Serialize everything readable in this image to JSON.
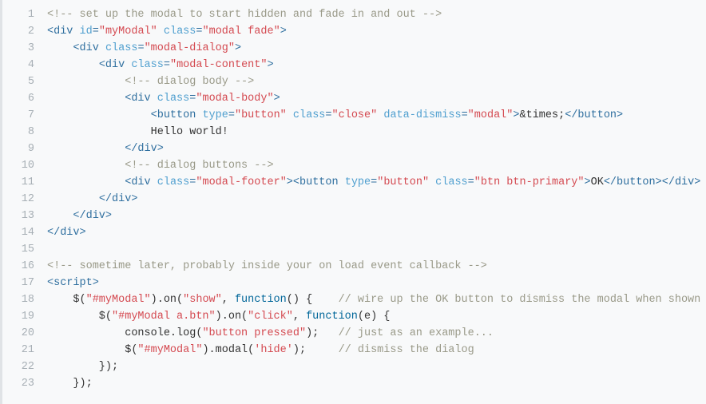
{
  "lines": [
    {
      "n": 1,
      "segs": [
        {
          "cls": "c",
          "t": "<!-- set up the modal to start hidden and fade in and out -->"
        }
      ]
    },
    {
      "n": 2,
      "segs": [
        {
          "cls": "p",
          "t": "<"
        },
        {
          "cls": "t",
          "t": "div"
        },
        {
          "cls": "x",
          "t": " "
        },
        {
          "cls": "a",
          "t": "id"
        },
        {
          "cls": "p",
          "t": "="
        },
        {
          "cls": "v",
          "t": "\"myModal\""
        },
        {
          "cls": "x",
          "t": " "
        },
        {
          "cls": "a",
          "t": "class"
        },
        {
          "cls": "p",
          "t": "="
        },
        {
          "cls": "v",
          "t": "\"modal fade\""
        },
        {
          "cls": "p",
          "t": ">"
        }
      ]
    },
    {
      "n": 3,
      "segs": [
        {
          "cls": "x",
          "t": "    "
        },
        {
          "cls": "p",
          "t": "<"
        },
        {
          "cls": "t",
          "t": "div"
        },
        {
          "cls": "x",
          "t": " "
        },
        {
          "cls": "a",
          "t": "class"
        },
        {
          "cls": "p",
          "t": "="
        },
        {
          "cls": "v",
          "t": "\"modal-dialog\""
        },
        {
          "cls": "p",
          "t": ">"
        }
      ]
    },
    {
      "n": 4,
      "segs": [
        {
          "cls": "x",
          "t": "        "
        },
        {
          "cls": "p",
          "t": "<"
        },
        {
          "cls": "t",
          "t": "div"
        },
        {
          "cls": "x",
          "t": " "
        },
        {
          "cls": "a",
          "t": "class"
        },
        {
          "cls": "p",
          "t": "="
        },
        {
          "cls": "v",
          "t": "\"modal-content\""
        },
        {
          "cls": "p",
          "t": ">"
        }
      ]
    },
    {
      "n": 5,
      "segs": [
        {
          "cls": "x",
          "t": "            "
        },
        {
          "cls": "c",
          "t": "<!-- dialog body -->"
        }
      ]
    },
    {
      "n": 6,
      "segs": [
        {
          "cls": "x",
          "t": "            "
        },
        {
          "cls": "p",
          "t": "<"
        },
        {
          "cls": "t",
          "t": "div"
        },
        {
          "cls": "x",
          "t": " "
        },
        {
          "cls": "a",
          "t": "class"
        },
        {
          "cls": "p",
          "t": "="
        },
        {
          "cls": "v",
          "t": "\"modal-body\""
        },
        {
          "cls": "p",
          "t": ">"
        }
      ]
    },
    {
      "n": 7,
      "segs": [
        {
          "cls": "x",
          "t": "                "
        },
        {
          "cls": "p",
          "t": "<"
        },
        {
          "cls": "t",
          "t": "button"
        },
        {
          "cls": "x",
          "t": " "
        },
        {
          "cls": "a",
          "t": "type"
        },
        {
          "cls": "p",
          "t": "="
        },
        {
          "cls": "v",
          "t": "\"button\""
        },
        {
          "cls": "x",
          "t": " "
        },
        {
          "cls": "a",
          "t": "class"
        },
        {
          "cls": "p",
          "t": "="
        },
        {
          "cls": "v",
          "t": "\"close\""
        },
        {
          "cls": "x",
          "t": " "
        },
        {
          "cls": "a",
          "t": "data-dismiss"
        },
        {
          "cls": "p",
          "t": "="
        },
        {
          "cls": "v",
          "t": "\"modal\""
        },
        {
          "cls": "p",
          "t": ">"
        },
        {
          "cls": "x",
          "t": "&times;"
        },
        {
          "cls": "p",
          "t": "</"
        },
        {
          "cls": "t",
          "t": "button"
        },
        {
          "cls": "p",
          "t": ">"
        }
      ]
    },
    {
      "n": 8,
      "segs": [
        {
          "cls": "x",
          "t": "                Hello world!"
        }
      ]
    },
    {
      "n": 9,
      "segs": [
        {
          "cls": "x",
          "t": "            "
        },
        {
          "cls": "p",
          "t": "</"
        },
        {
          "cls": "t",
          "t": "div"
        },
        {
          "cls": "p",
          "t": ">"
        }
      ]
    },
    {
      "n": 10,
      "segs": [
        {
          "cls": "x",
          "t": "            "
        },
        {
          "cls": "c",
          "t": "<!-- dialog buttons -->"
        }
      ]
    },
    {
      "n": 11,
      "segs": [
        {
          "cls": "x",
          "t": "            "
        },
        {
          "cls": "p",
          "t": "<"
        },
        {
          "cls": "t",
          "t": "div"
        },
        {
          "cls": "x",
          "t": " "
        },
        {
          "cls": "a",
          "t": "class"
        },
        {
          "cls": "p",
          "t": "="
        },
        {
          "cls": "v",
          "t": "\"modal-footer\""
        },
        {
          "cls": "p",
          "t": "><"
        },
        {
          "cls": "t",
          "t": "button"
        },
        {
          "cls": "x",
          "t": " "
        },
        {
          "cls": "a",
          "t": "type"
        },
        {
          "cls": "p",
          "t": "="
        },
        {
          "cls": "v",
          "t": "\"button\""
        },
        {
          "cls": "x",
          "t": " "
        },
        {
          "cls": "a",
          "t": "class"
        },
        {
          "cls": "p",
          "t": "="
        },
        {
          "cls": "v",
          "t": "\"btn btn-primary\""
        },
        {
          "cls": "p",
          "t": ">"
        },
        {
          "cls": "x",
          "t": "OK"
        },
        {
          "cls": "p",
          "t": "</"
        },
        {
          "cls": "t",
          "t": "button"
        },
        {
          "cls": "p",
          "t": "></"
        },
        {
          "cls": "t",
          "t": "div"
        },
        {
          "cls": "p",
          "t": ">"
        }
      ]
    },
    {
      "n": 12,
      "segs": [
        {
          "cls": "x",
          "t": "        "
        },
        {
          "cls": "p",
          "t": "</"
        },
        {
          "cls": "t",
          "t": "div"
        },
        {
          "cls": "p",
          "t": ">"
        }
      ]
    },
    {
      "n": 13,
      "segs": [
        {
          "cls": "x",
          "t": "    "
        },
        {
          "cls": "p",
          "t": "</"
        },
        {
          "cls": "t",
          "t": "div"
        },
        {
          "cls": "p",
          "t": ">"
        }
      ]
    },
    {
      "n": 14,
      "segs": [
        {
          "cls": "p",
          "t": "</"
        },
        {
          "cls": "t",
          "t": "div"
        },
        {
          "cls": "p",
          "t": ">"
        }
      ]
    },
    {
      "n": 15,
      "segs": []
    },
    {
      "n": 16,
      "segs": [
        {
          "cls": "c",
          "t": "<!-- sometime later, probably inside your on load event callback -->"
        }
      ]
    },
    {
      "n": 17,
      "segs": [
        {
          "cls": "p",
          "t": "<"
        },
        {
          "cls": "t",
          "t": "script"
        },
        {
          "cls": "p",
          "t": ">"
        }
      ]
    },
    {
      "n": 18,
      "segs": [
        {
          "cls": "x",
          "t": "    $("
        },
        {
          "cls": "v",
          "t": "\"#myModal\""
        },
        {
          "cls": "x",
          "t": ").on("
        },
        {
          "cls": "v",
          "t": "\"show\""
        },
        {
          "cls": "x",
          "t": ", "
        },
        {
          "cls": "k",
          "t": "function"
        },
        {
          "cls": "x",
          "t": "() {    "
        },
        {
          "cls": "c",
          "t": "// wire up the OK button to dismiss the modal when shown"
        }
      ]
    },
    {
      "n": 19,
      "segs": [
        {
          "cls": "x",
          "t": "        $("
        },
        {
          "cls": "v",
          "t": "\"#myModal a.btn\""
        },
        {
          "cls": "x",
          "t": ").on("
        },
        {
          "cls": "v",
          "t": "\"click\""
        },
        {
          "cls": "x",
          "t": ", "
        },
        {
          "cls": "k",
          "t": "function"
        },
        {
          "cls": "x",
          "t": "(e) {"
        }
      ]
    },
    {
      "n": 20,
      "segs": [
        {
          "cls": "x",
          "t": "            console.log("
        },
        {
          "cls": "v",
          "t": "\"button pressed\""
        },
        {
          "cls": "x",
          "t": ");   "
        },
        {
          "cls": "c",
          "t": "// just as an example..."
        }
      ]
    },
    {
      "n": 21,
      "segs": [
        {
          "cls": "x",
          "t": "            $("
        },
        {
          "cls": "v",
          "t": "\"#myModal\""
        },
        {
          "cls": "x",
          "t": ").modal("
        },
        {
          "cls": "v",
          "t": "'hide'"
        },
        {
          "cls": "x",
          "t": ");     "
        },
        {
          "cls": "c",
          "t": "// dismiss the dialog"
        }
      ]
    },
    {
      "n": 22,
      "segs": [
        {
          "cls": "x",
          "t": "        });"
        }
      ]
    },
    {
      "n": 23,
      "segs": [
        {
          "cls": "x",
          "t": "    });"
        }
      ]
    }
  ]
}
